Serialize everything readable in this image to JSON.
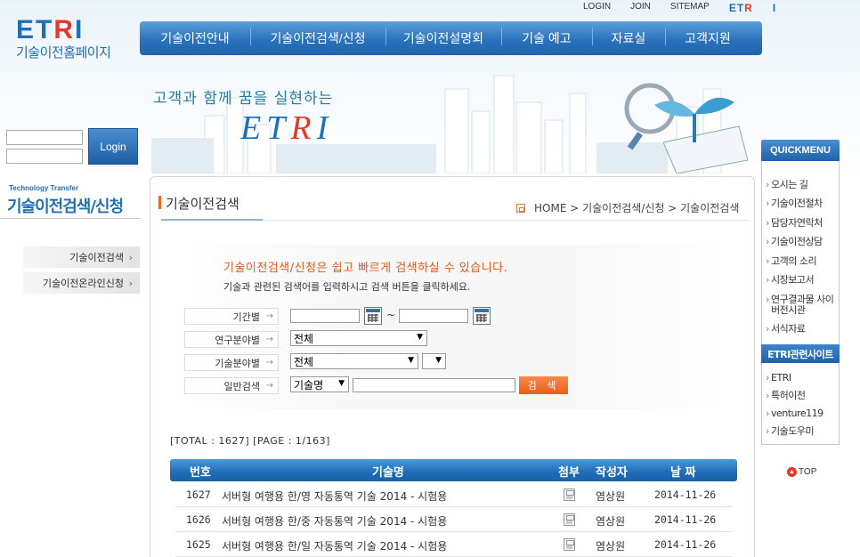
{
  "brand": {
    "logo_mark": "ETRI",
    "logo_sub": "기술이전홈페이지"
  },
  "util": {
    "login": "LOGIN",
    "join": "JOIN",
    "sitemap": "SITEMAP",
    "etri": "ETRI"
  },
  "gnb": [
    "기술이전안내",
    "기술이전검색/신청",
    "기술이전설명회",
    "기술 예고",
    "자료실",
    "고객지원"
  ],
  "hero": {
    "slogan": "고객과 함께 꿈을 실현하는",
    "mark": "ETRI"
  },
  "login": {
    "button": "Login"
  },
  "lnb": {
    "eng": "Technology Transfer",
    "title": "기술이전검색/신청",
    "items": [
      "기술이전검색",
      "기술이전온라인신청"
    ]
  },
  "page": {
    "title": "기술이전검색",
    "breadcrumb": "HOME > 기술이전검색/신청 > 기술이전검색"
  },
  "search": {
    "heading": "기술이전검색/신청은 쉽고 빠르게 검색하실 수 있습니다.",
    "description": "기술과 관련된 검색어를 입력하시고 검색 버튼을 클릭하세요.",
    "labels": {
      "period": "기간별",
      "research_field": "연구분야별",
      "tech_field": "기술분야별",
      "general": "일반검색"
    },
    "tilde": "~",
    "research_field_value": "전체",
    "tech_field_value": "전체",
    "general_type": "기술명",
    "button": "검 색"
  },
  "totals": "[TOTAL : 1627] [PAGE : 1/163]",
  "table": {
    "headers": {
      "no": "번호",
      "title": "기술명",
      "attach": "첨부",
      "author": "작성자",
      "date": "날 짜"
    },
    "rows": [
      {
        "no": "1627",
        "title": "서버형 여행용 한/영 자동통역 기술 2014 - 시험용",
        "author": "염상원",
        "date": "2014-11-26"
      },
      {
        "no": "1626",
        "title": "서버형 여행용 한/중 자동통역 기술 2014 - 시험용",
        "author": "염상원",
        "date": "2014-11-26"
      },
      {
        "no": "1625",
        "title": "서버형 여행용 한/일 자동통역 기술 2014 - 시험용",
        "author": "염상원",
        "date": "2014-11-26"
      }
    ]
  },
  "quickmenu": {
    "title": "QUICKMENU",
    "items": [
      "오시는 길",
      "기술이전절차",
      "담당자연락처",
      "기술이전상담",
      "고객의 소리",
      "시장보고서",
      "연구결과물 사이버전시관",
      "서식자료"
    ],
    "related_title": "ETRI관련사이트",
    "related": [
      "ETRI",
      "특허이전",
      "venture119",
      "기술도우미"
    ],
    "top": "TOP"
  },
  "colors": {
    "brand_blue": "#1f6fb5",
    "accent_orange": "#e85f1d",
    "brand_red": "#e03a2a"
  }
}
